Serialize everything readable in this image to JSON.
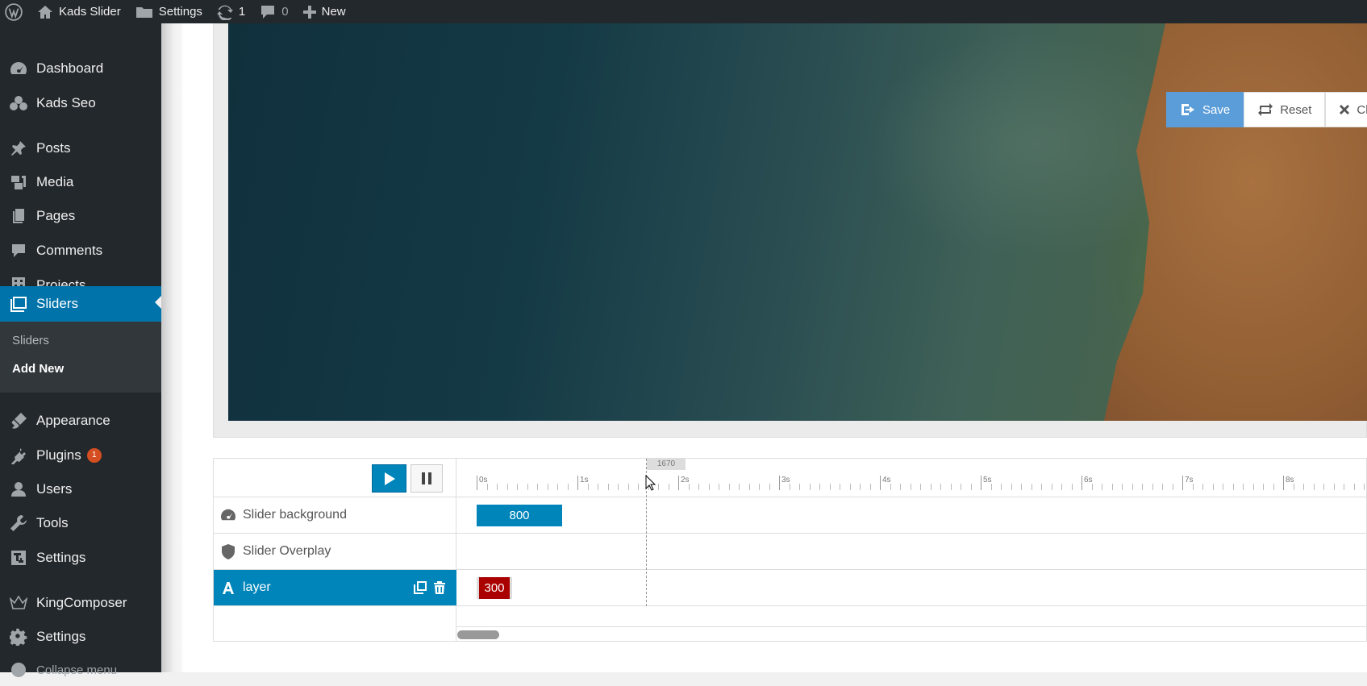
{
  "admin_bar": {
    "site_name": "Kads Slider",
    "settings_label": "Settings",
    "updates_count": "1",
    "comments_count": "0",
    "new_label": "New"
  },
  "sidebar": {
    "items": [
      {
        "label": "Dashboard",
        "icon": "dashboard-icon"
      },
      {
        "label": "Kads Seo",
        "icon": "seo-icon"
      },
      {
        "label": "Posts",
        "icon": "pin-icon"
      },
      {
        "label": "Media",
        "icon": "media-icon"
      },
      {
        "label": "Pages",
        "icon": "pages-icon"
      },
      {
        "label": "Comments",
        "icon": "comments-icon"
      },
      {
        "label": "Projects",
        "icon": "projects-icon"
      },
      {
        "label": "Sliders",
        "icon": "sliders-icon"
      },
      {
        "label": "Appearance",
        "icon": "appearance-icon"
      },
      {
        "label": "Plugins",
        "icon": "plugins-icon",
        "badge": "1"
      },
      {
        "label": "Users",
        "icon": "users-icon"
      },
      {
        "label": "Tools",
        "icon": "tools-icon"
      },
      {
        "label": "Settings",
        "icon": "settings-icon"
      },
      {
        "label": "KingComposer",
        "icon": "kingcomposer-icon"
      },
      {
        "label": "Settings",
        "icon": "settings-icon"
      },
      {
        "label": "Collapse menu",
        "icon": "collapse-icon"
      }
    ],
    "submenu": [
      {
        "label": "Sliders"
      },
      {
        "label": "Add New"
      }
    ]
  },
  "actions": {
    "save_label": "Save",
    "reset_label": "Reset",
    "close_label": "Close"
  },
  "timeline": {
    "cursor_value": "1670",
    "scale_labels": [
      "0s",
      "1s",
      "2s",
      "3s",
      "4s",
      "5s",
      "6s",
      "7s",
      "8s"
    ],
    "layers": [
      {
        "name": "Slider background",
        "icon": "dashboard-icon",
        "duration": "800",
        "color": "#0085ba"
      },
      {
        "name": "Slider Overplay",
        "icon": "shield-icon"
      },
      {
        "name": "layer",
        "icon": "text-icon",
        "duration": "300",
        "color": "#aa0000",
        "selected": true
      }
    ]
  },
  "colors": {
    "admin_dark": "#23282d",
    "accent": "#0073aa",
    "timeline_blue": "#0085ba",
    "save_blue": "#5b9dd9",
    "layer_red": "#aa0000"
  }
}
